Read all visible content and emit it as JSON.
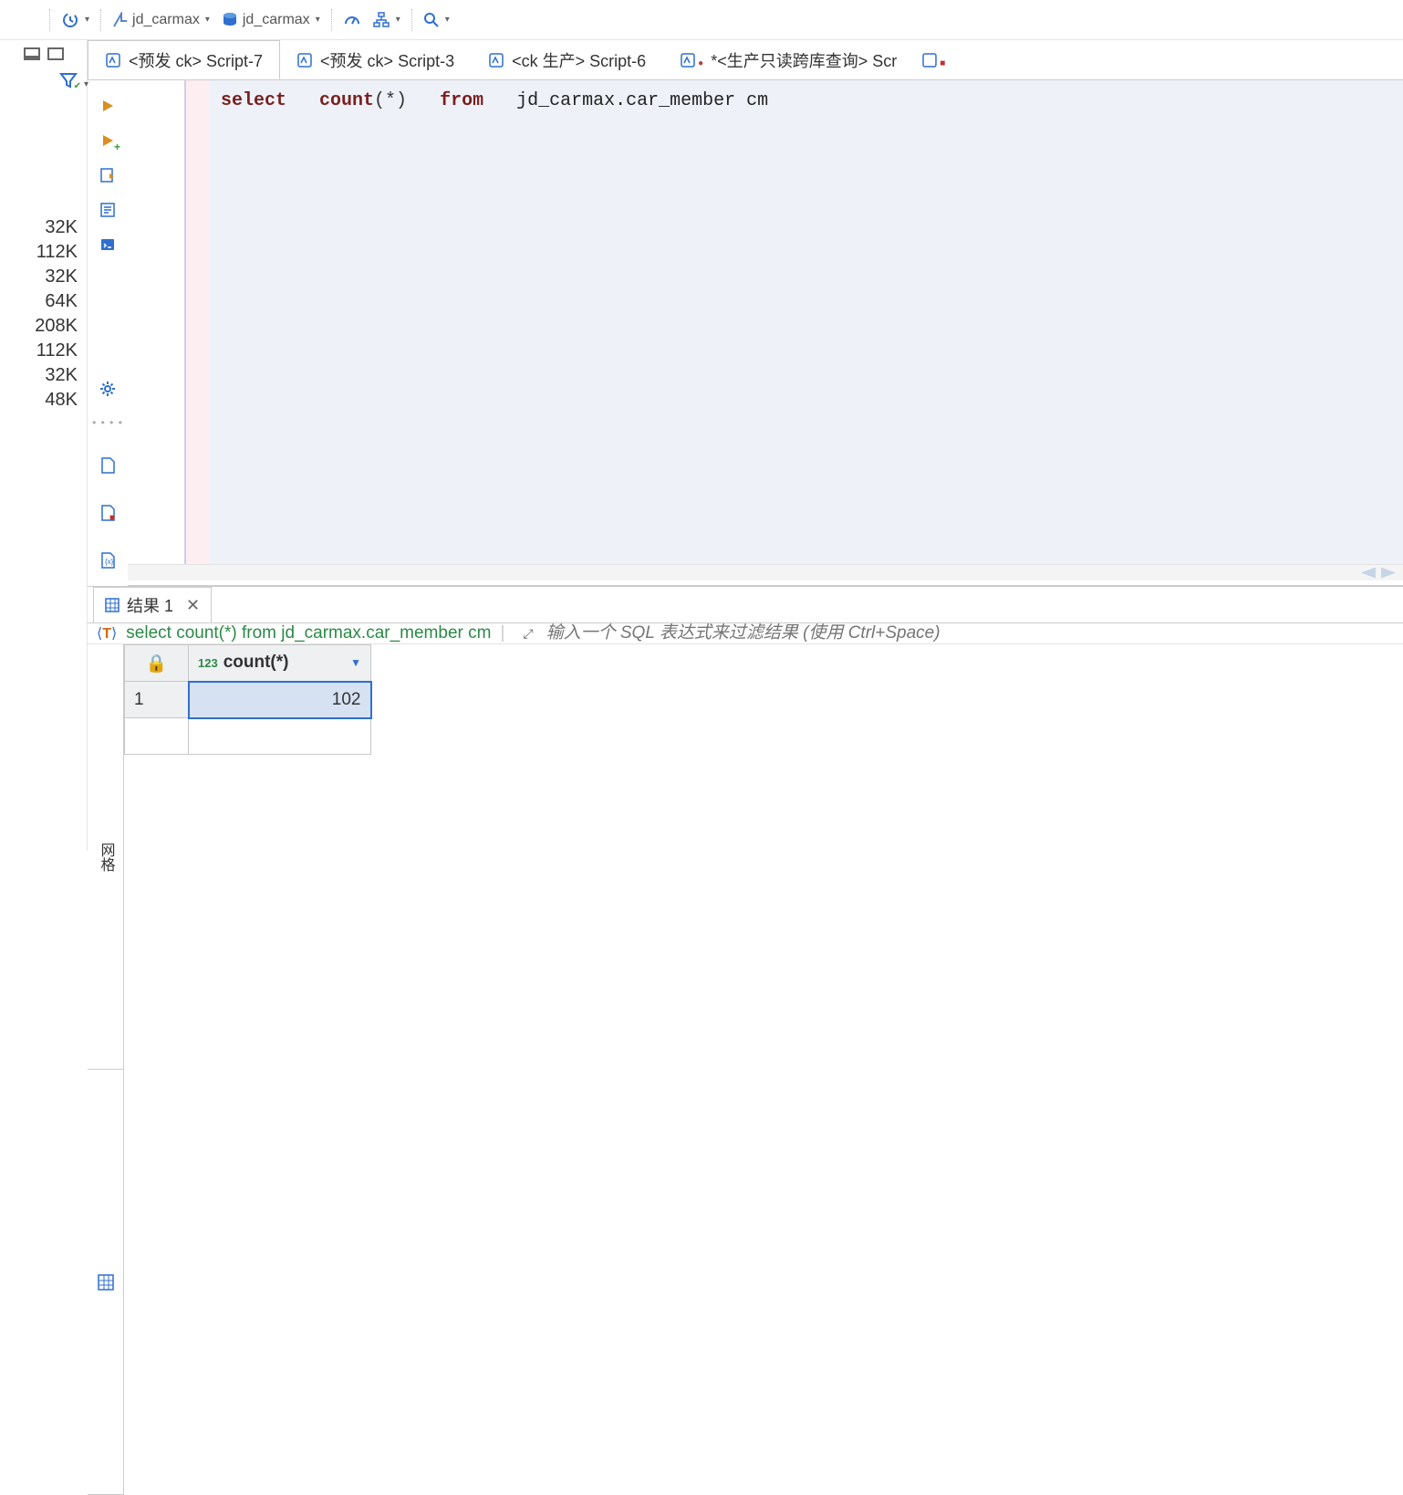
{
  "toolbar": {
    "schema_selector": "jd_carmax",
    "db_selector": "jd_carmax"
  },
  "left_panel": {
    "sizes": [
      "32K",
      "112K",
      "32K",
      "64K",
      "208K",
      "112K",
      "32K",
      "48K"
    ]
  },
  "tabs": [
    {
      "label": "<预发 ck> Script-7",
      "modified": false,
      "active": true
    },
    {
      "label": "<预发 ck> Script-3",
      "modified": false,
      "active": false
    },
    {
      "label": "<ck 生产> Script-6",
      "modified": false,
      "active": false
    },
    {
      "label": "*<生产只读跨库查询> Scr",
      "modified": true,
      "active": false
    }
  ],
  "editor": {
    "sql_tokens": {
      "select": "select",
      "count": "count",
      "star_paren": "(*)",
      "from": "from",
      "table": "jd_carmax.car_member cm"
    },
    "raw_sql": "select  count(*)  from  jd_carmax.car_member cm"
  },
  "results": {
    "tab_label": "结果 1",
    "query_text": "select count(*) from jd_carmax.car_member cm",
    "filter_placeholder": "输入一个 SQL 表达式来过滤结果 (使用 Ctrl+Space)",
    "side_tab_grid": "网格",
    "column": {
      "type_label": "123",
      "name": "count(*)"
    },
    "rows": [
      {
        "n": "1",
        "value": "102"
      }
    ]
  }
}
